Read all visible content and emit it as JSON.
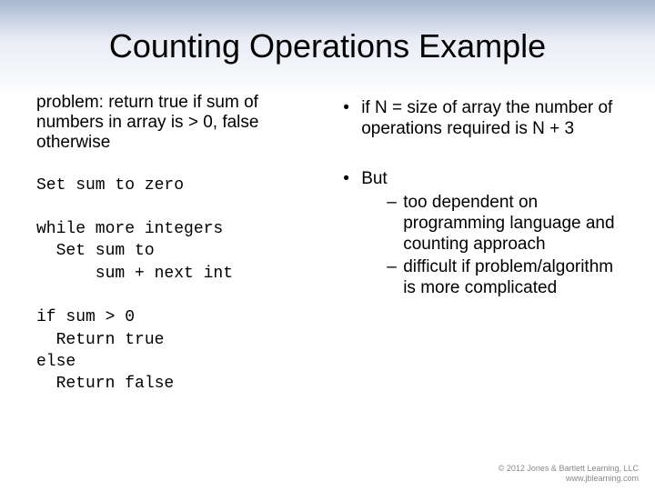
{
  "title": "Counting Operations Example",
  "problem": "problem: return true if sum of numbers in array is > 0, false otherwise",
  "codeLines": [
    "Set sum to zero",
    "",
    "while more integers",
    "  Set sum to",
    "      sum + next int",
    "",
    "if sum > 0",
    "  Return true",
    "else",
    "  Return false"
  ],
  "bullets": [
    {
      "text": "if N = size of array the number of operations required is N + 3",
      "sub": []
    },
    {
      "text": "But",
      "sub": [
        "too dependent on programming language and counting approach",
        "difficult if problem/algorithm is more complicated"
      ]
    }
  ],
  "footer": {
    "line1": "© 2012 Jones & Bartlett Learning, LLC",
    "line2": "www.jblearning.com"
  }
}
